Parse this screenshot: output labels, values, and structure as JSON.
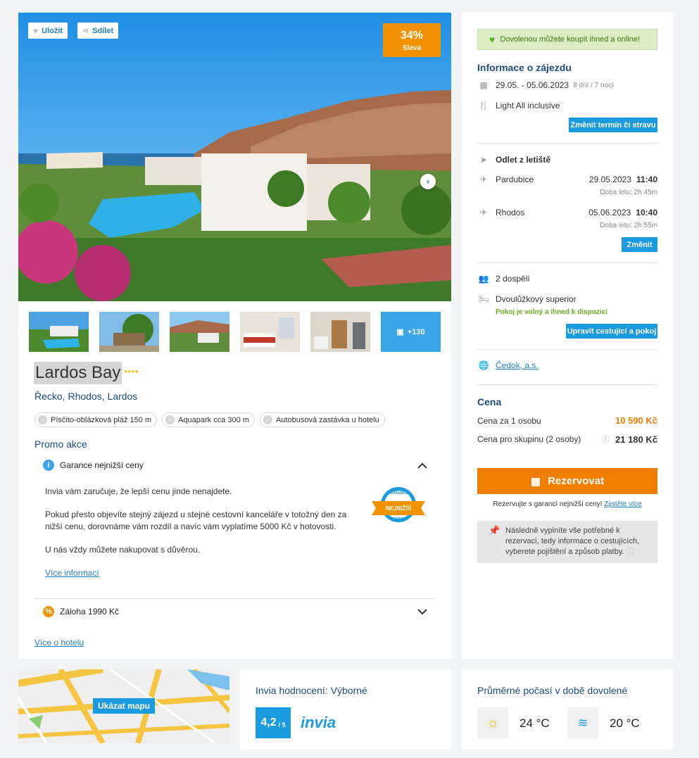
{
  "gallery": {
    "save_label": "Uložit",
    "share_label": "Sdílet",
    "discount_percent": "34%",
    "discount_label": "Sleva",
    "more_photos": "+130"
  },
  "hotel": {
    "name": "Lardos Bay",
    "stars": 4,
    "location": "Řecko, Rhodos, Lardos",
    "features": [
      "Písčito-oblázková pláž 150 m",
      "Aquapark cca 300 m",
      "Autobusová zastávka u hotelu"
    ]
  },
  "promo": {
    "heading": "Promo akce",
    "guarantee_title": "Garance nejnižší ceny",
    "guarantee_p1": "Invia vám zaručuje, že lepší cenu jinde nenajdete.",
    "guarantee_p2": "Pokud přesto objevíte stejný zájezd u stejné cestovní kanceláře v totožný den za nižší cenu, dorovnáme vám rozdíl a navíc vám vyplatíme 5000 Kč v hotovosti.",
    "guarantee_p3": "U nás vždy můžete nakupovat s důvěrou.",
    "more_info": "Více informací",
    "badge_top": "GARANCE",
    "badge_mid": "NEJNIŽŠÍ",
    "badge_bottom": "CENY",
    "deposit_title": "Záloha 1990 Kč",
    "more_hotel": "Více o hotelu"
  },
  "booking": {
    "availability": "Dovolenou můžete koupit ihned a online!",
    "info_heading": "Informace o zájezdu",
    "dates": "29.05. - 05.06.2023",
    "duration": "8 dní / 7 nocí",
    "board": "Light All inclusive",
    "change_term_btn": "Změnit termín či stravu",
    "departure_heading": "Odlet z letiště",
    "outbound_from": "Pardubice",
    "outbound_date": "29.05.2023",
    "outbound_time": "11:40",
    "outbound_duration": "Doba letu: 2h 45m",
    "return_from": "Rhodos",
    "return_date": "05.06.2023",
    "return_time": "10:40",
    "return_duration": "Doba letu: 2h 55m",
    "change_btn": "Změnit",
    "travellers": "2 dospělí",
    "room": "Dvoulůžkový superior",
    "room_status": "Pokoj je volný a ihned k dispozici",
    "edit_btn": "Upravit cestující a pokoj",
    "operator": "Čedok, a.s.",
    "price_heading": "Cena",
    "price_person_label": "Cena za 1 osobu",
    "price_person": "10 590 Kč",
    "price_group_label": "Cena pro skupinu (2 osoby)",
    "price_group": "21 180 Kč",
    "reserve_btn": "Rezervovat",
    "guarantee_note": "Rezervujte s garancí nejnižší ceny!",
    "guarantee_link": "Zjistěte více",
    "next_steps": "Následně vyplníte vše potřebné k rezervaci, tedy informace o cestujících, vyberete pojištění a způsob platby."
  },
  "map": {
    "button": "Ukázat mapu"
  },
  "rating": {
    "heading": "Invia hodnocení: Výborné",
    "score": "4,2",
    "scale": "/ 5",
    "brand": "invia"
  },
  "weather": {
    "heading": "Průměrné počasí v době dovolené",
    "air_temp": "24 °C",
    "water_temp": "20 °C"
  },
  "colors": {
    "accent_blue": "#1a9be0",
    "heading_blue": "#1a4e7e",
    "orange": "#ef7d00",
    "green": "#7cc242"
  }
}
